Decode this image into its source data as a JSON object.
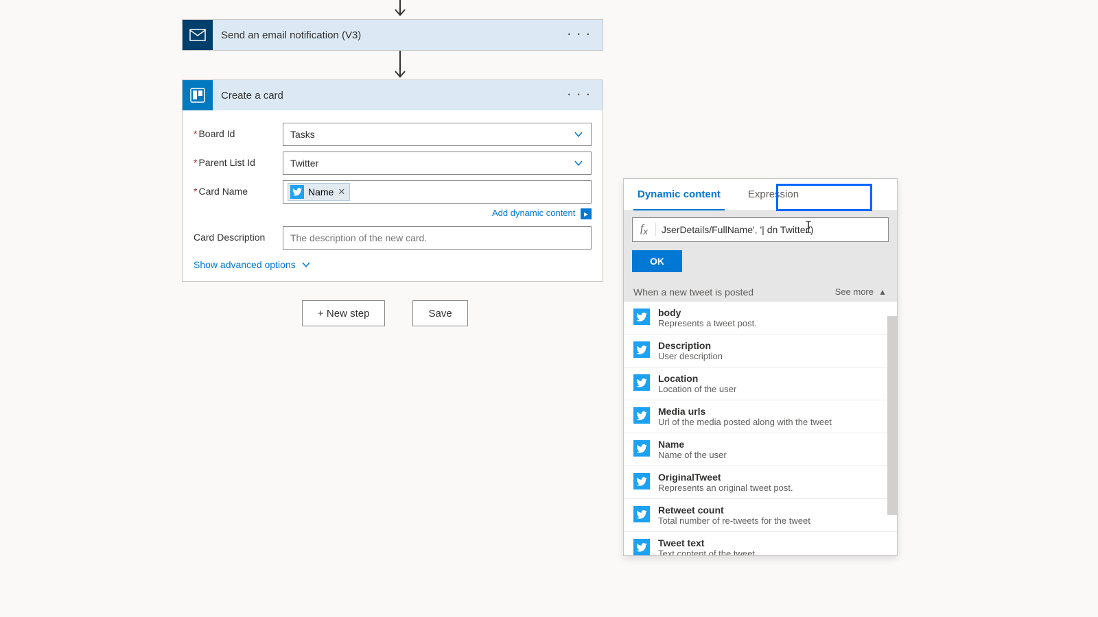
{
  "steps": {
    "email": {
      "title": "Send an email notification (V3)"
    },
    "trello": {
      "title": "Create a card",
      "fields": {
        "board": {
          "label": "Board Id",
          "value": "Tasks"
        },
        "list": {
          "label": "Parent List Id",
          "value": "Twitter"
        },
        "name": {
          "label": "Card Name",
          "token": "Name"
        },
        "desc": {
          "label": "Card Description",
          "placeholder": "The description of the new card."
        }
      },
      "add_dynamic": "Add dynamic content",
      "advanced": "Show advanced options"
    }
  },
  "buttons": {
    "new_step": "+ New step",
    "save": "Save"
  },
  "dyn": {
    "tabs": {
      "dynamic": "Dynamic content",
      "expression": "Expression"
    },
    "expression_prefix": "JserDetails/FullName'",
    "expression_highlight": "'| dn Twitter')",
    "ok": "OK",
    "section_title": "When a new tweet is posted",
    "see_more": "See more",
    "items": [
      {
        "name": "body",
        "desc": "Represents a tweet post."
      },
      {
        "name": "Description",
        "desc": "User description"
      },
      {
        "name": "Location",
        "desc": "Location of the user"
      },
      {
        "name": "Media urls",
        "desc": "Url of the media posted along with the tweet"
      },
      {
        "name": "Name",
        "desc": "Name of the user"
      },
      {
        "name": "OriginalTweet",
        "desc": "Represents an original tweet post."
      },
      {
        "name": "Retweet count",
        "desc": "Total number of re-tweets for the tweet"
      },
      {
        "name": "Tweet text",
        "desc": "Text content of the tweet"
      }
    ]
  }
}
